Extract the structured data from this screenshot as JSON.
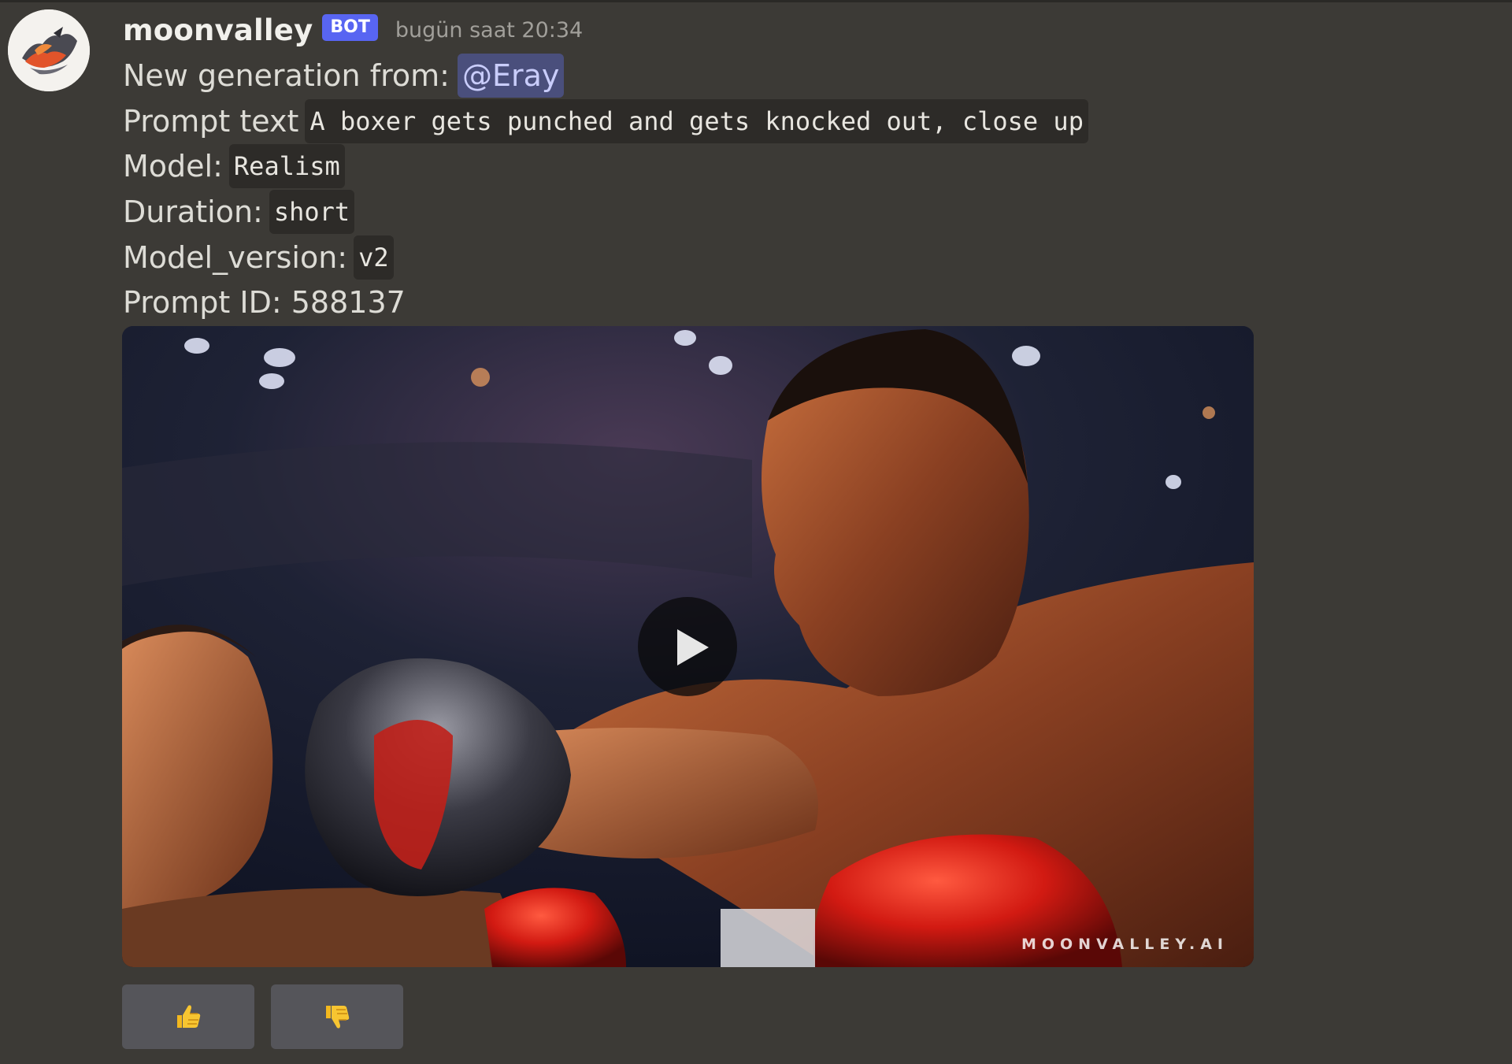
{
  "message": {
    "author": "moonvalley",
    "bot_badge": "BOT",
    "timestamp": "bugün saat 20:34",
    "generation_label": "New generation from:",
    "mention": "@Eray",
    "prompt_label": "Prompt text",
    "prompt_value": "A boxer gets punched and gets knocked out, close up",
    "model_label": "Model:",
    "model_value": "Realism",
    "duration_label": "Duration:",
    "duration_value": "short",
    "model_version_label": "Model_version:",
    "model_version_value": "v2",
    "prompt_id_line": "Prompt ID: 588137"
  },
  "media": {
    "type": "video",
    "watermark": "MOONVALLEY.AI",
    "play_icon": "play-icon"
  },
  "buttons": [
    {
      "icon": "thumbs-up-icon",
      "glyph": "👍"
    },
    {
      "icon": "thumbs-down-icon",
      "glyph": "👎"
    }
  ],
  "colors": {
    "background": "#3c3a36",
    "bot_badge": "#5865f2",
    "mention_bg": "#4a4f7c",
    "code_bg": "#2d2b28",
    "button_bg": "#55555a"
  }
}
